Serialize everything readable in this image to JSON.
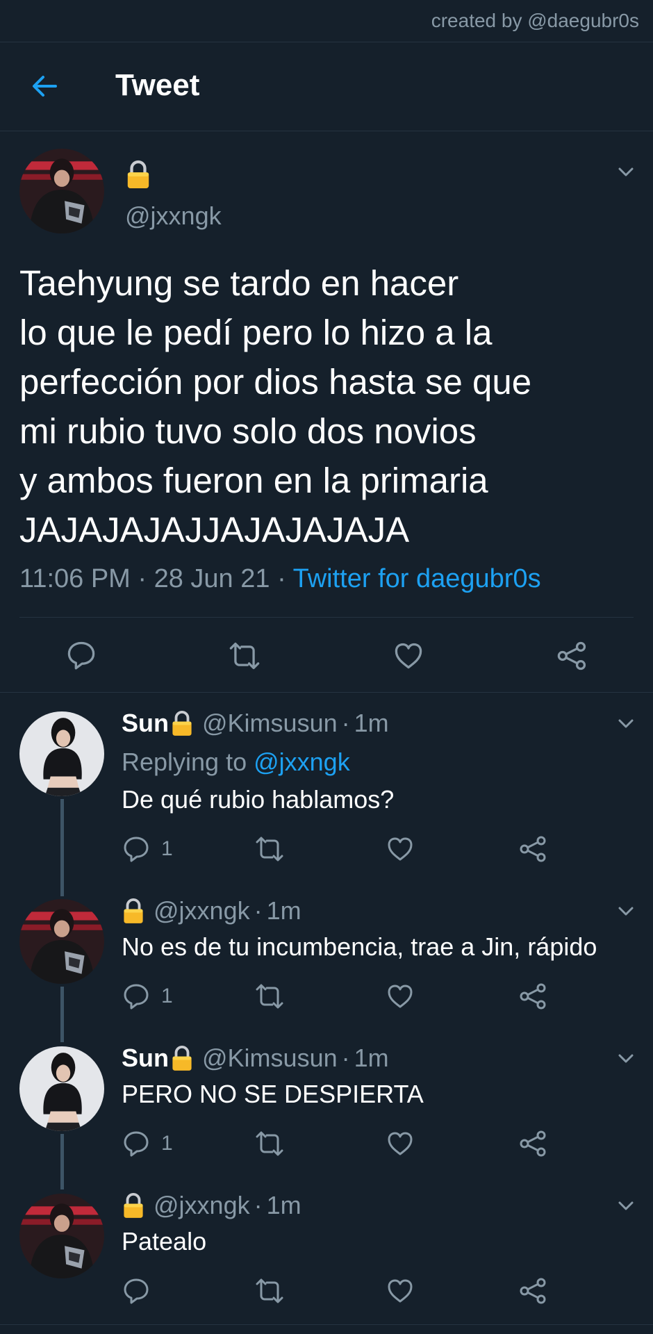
{
  "credit": "created by @daegubr0s",
  "header": {
    "title": "Tweet"
  },
  "main_tweet": {
    "handle": "@jxxngk",
    "text": "Taehyung se tardo en hacer\nlo que le pedí pero lo hizo a la\nperfección por dios hasta se que\nmi rubio tuvo solo dos novios\ny ambos fueron en la primaria\nJAJAJAJAJJAJAJAJAJA",
    "time": "11:06 PM · 28 Jun 21 · ",
    "source": "Twitter for daegubr0s"
  },
  "replies": [
    {
      "name": "Sun",
      "handle": "@Kimsusun",
      "time": "1m",
      "replying_prefix": "Replying to ",
      "replying_to": "@jxxngk",
      "text": "De qué rubio hablamos?",
      "reply_count": "1"
    },
    {
      "name": "",
      "handle": "@jxxngk",
      "time": "1m",
      "text": "No es de tu incumbencia, trae a Jin, rápido",
      "reply_count": "1"
    },
    {
      "name": "Sun",
      "handle": "@Kimsusun",
      "time": "1m",
      "text": "PERO NO SE DESPIERTA",
      "reply_count": "1"
    },
    {
      "name": "",
      "handle": "@jxxngk",
      "time": "1m",
      "text": "Patealo",
      "reply_count": ""
    }
  ],
  "icons": {
    "back": "arrow-left-icon",
    "lock": "lock-icon",
    "caret": "chevron-down-icon",
    "reply": "reply-icon",
    "retweet": "retweet-icon",
    "like": "heart-icon",
    "share": "share-icon"
  },
  "colors": {
    "background": "#15202b",
    "accent": "#1da1f2",
    "secondary_text": "#8899a6",
    "divider": "#253341"
  }
}
